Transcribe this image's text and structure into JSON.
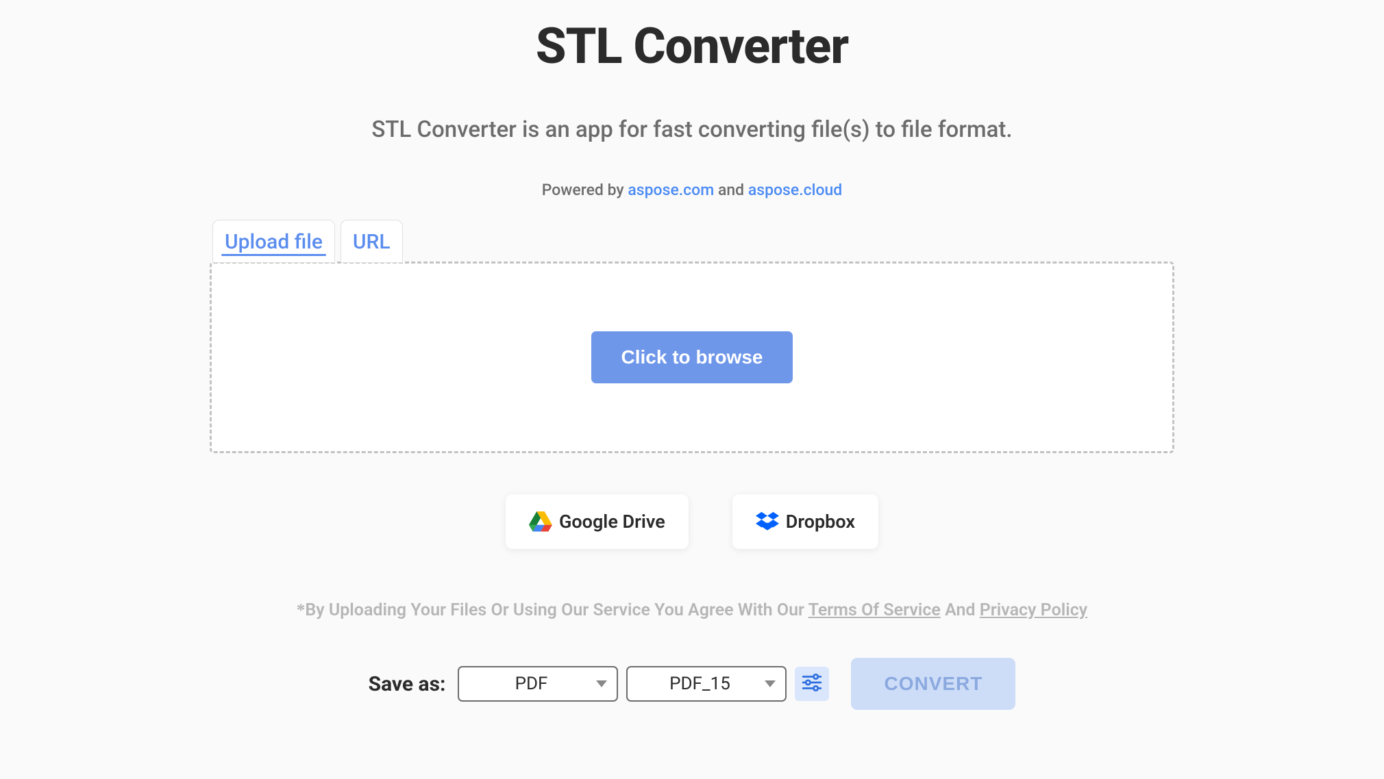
{
  "header": {
    "title": "STL Converter",
    "subtitle": "STL Converter is an app for fast converting file(s) to file format."
  },
  "powered": {
    "prefix": "Powered by ",
    "link1_label": "aspose.com",
    "middle": " and ",
    "link2_label": "aspose.cloud"
  },
  "tabs": {
    "upload_label": "Upload file",
    "url_label": "URL"
  },
  "dropzone": {
    "browse_label": "Click to browse"
  },
  "cloud": {
    "google_drive_label": "Google Drive",
    "dropbox_label": "Dropbox"
  },
  "disclaimer": {
    "asterisk": "*",
    "text_before": "By Uploading Your Files Or Using Our Service You Agree With Our ",
    "tos_label": "Terms Of Service",
    "text_middle": " And ",
    "privacy_label": "Privacy Policy"
  },
  "save": {
    "label": "Save as:",
    "format_selected": "PDF",
    "subformat_selected": "PDF_15",
    "convert_label": "CONVERT"
  }
}
